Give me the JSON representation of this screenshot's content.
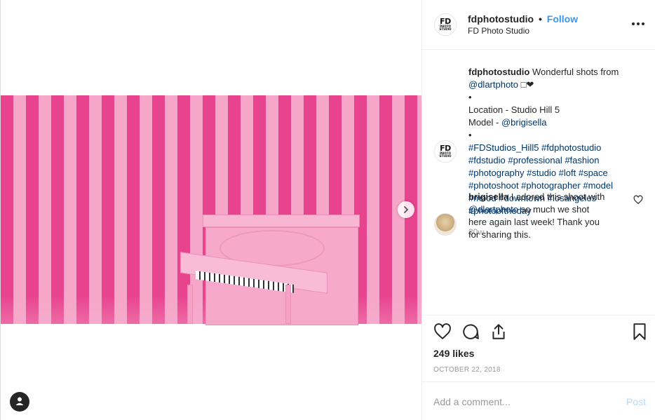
{
  "post": {
    "username": "fdphotostudio",
    "separator": "•",
    "follow_label": "Follow",
    "location_name": "FD Photo Studio",
    "logo_text_main": "FD",
    "logo_text_sub": "PHOTO STUDIO"
  },
  "caption": {
    "username": "fdphotostudio",
    "line1": "Wonderful shots from",
    "mention_photographer": "@dlartphoto",
    "emoji": "□❤",
    "bullet": "•",
    "location_line": "Location - Studio Hill 5",
    "model_prefix": "Model - ",
    "model_mention": "@brigisella",
    "hashtag_lines": [
      "#FDStudios_Hill5 #fdphotostudio",
      "#fdstudio #professional #fashion",
      "#photography #studio #loft #space",
      "#photoshoot #photographer #model",
      "#mood #downtown #losangeles",
      "#photooftheday"
    ],
    "time_ago": "30w"
  },
  "comment": {
    "username": "brigisella",
    "text_a": "I adored this shoot with",
    "mention": "@dlartphoto",
    "text_b": "so much we shot",
    "text_c": "here again last week! Thank you",
    "text_d": "for sharing this."
  },
  "engagement": {
    "likes": "249 likes",
    "date": "OCTOBER 22, 2018"
  },
  "composer": {
    "placeholder": "Add a comment...",
    "post_label": "Post"
  },
  "icons": {
    "more": "more-options-icon",
    "next": "chevron-right-icon",
    "like": "heart-icon",
    "comment": "comment-icon",
    "share": "share-icon",
    "save": "bookmark-icon",
    "user": "user-icon"
  },
  "colors": {
    "link": "#003569",
    "follow": "#3897f0",
    "post_disabled": "#b3dbff",
    "stripe_dark": "#e8448e",
    "stripe_light": "#f6a6c8"
  }
}
